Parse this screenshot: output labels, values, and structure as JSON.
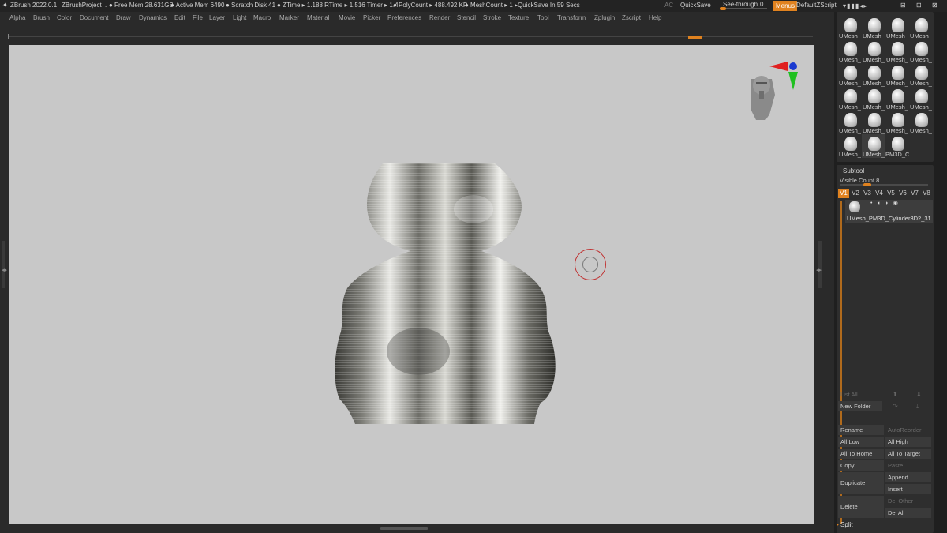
{
  "titlebar": {
    "app": "ZBrush 2022.0.1",
    "project": "ZBrushProject",
    "dot": ".",
    "free_mem": "● Free Mem 28.631GB",
    "active_mem": "● Active Mem 6490",
    "scratch": "● Scratch Disk 41",
    "ztime": "● ZTime ▸ 1.188 RTime ▸ 1.516 Timer ▸ 1.4",
    "polycount": "● PolyCount ▸ 488.492 KP",
    "meshcount": "● MeshCount ▸ 1",
    "quicksave_in": "▸QuickSave In 59 Secs",
    "ac": "AC",
    "quicksave": "QuickSave",
    "see_through": "See-through",
    "see_through_value": "0",
    "menus": "Menus",
    "default_zscript": "DefaultZScript",
    "ctrl_icons": "▾▮▮▮◂▸"
  },
  "menubar": [
    "Alpha",
    "Brush",
    "Color",
    "Document",
    "Draw",
    "Dynamics",
    "Edit",
    "File",
    "Layer",
    "Light",
    "Macro",
    "Marker",
    "Material",
    "Movie",
    "Picker",
    "Preferences",
    "Render",
    "Stencil",
    "Stroke",
    "Texture",
    "Tool",
    "Transform",
    "Zplugin",
    "Zscript",
    "Help"
  ],
  "window_controls": {
    "minimize": "⊟",
    "maximize": "⊡",
    "close": "⊠"
  },
  "library": {
    "rows": [
      [
        "UMesh_",
        "UMesh_",
        "UMesh_",
        "UMesh_"
      ],
      [
        "UMesh_",
        "UMesh_",
        "UMesh_",
        "UMesh_"
      ],
      [
        "UMesh_",
        "UMesh_",
        "UMesh_",
        "UMesh_"
      ],
      [
        "UMesh_",
        "UMesh_",
        "UMesh_",
        "UMesh_"
      ],
      [
        "UMesh_",
        "UMesh_",
        "UMesh_",
        "UMesh_"
      ],
      [
        "UMesh_",
        "UMesh_",
        "PM3D_C"
      ]
    ]
  },
  "subtool": {
    "title": "Subtool",
    "visible_count_label": "Visible Count",
    "visible_count": "8",
    "tabs": [
      "V1",
      "V2",
      "V3",
      "V4",
      "V5",
      "V6",
      "V7",
      "V8"
    ],
    "active_tab": "V1",
    "item_name": "UMesh_PM3D_Cylinder3D2_31",
    "item_icons": "• ◖ ◗ ◉"
  },
  "buttons": {
    "list_all": "List All",
    "new_folder": "New Folder",
    "rename": "Rename",
    "auto_reorder": "AutoReorder",
    "all_low": "All Low",
    "all_high": "All High",
    "all_to_home": "All To Home",
    "all_to_target": "All To Target",
    "copy": "Copy",
    "paste": "Paste",
    "duplicate": "Duplicate",
    "append": "Append",
    "insert": "Insert",
    "delete": "Delete",
    "del_other": "Del Other",
    "del_all": "Del All",
    "split": "Split"
  },
  "colors": {
    "accent": "#e0821f",
    "canvas": "#c8c8c8",
    "panel": "#2e2e2e"
  }
}
